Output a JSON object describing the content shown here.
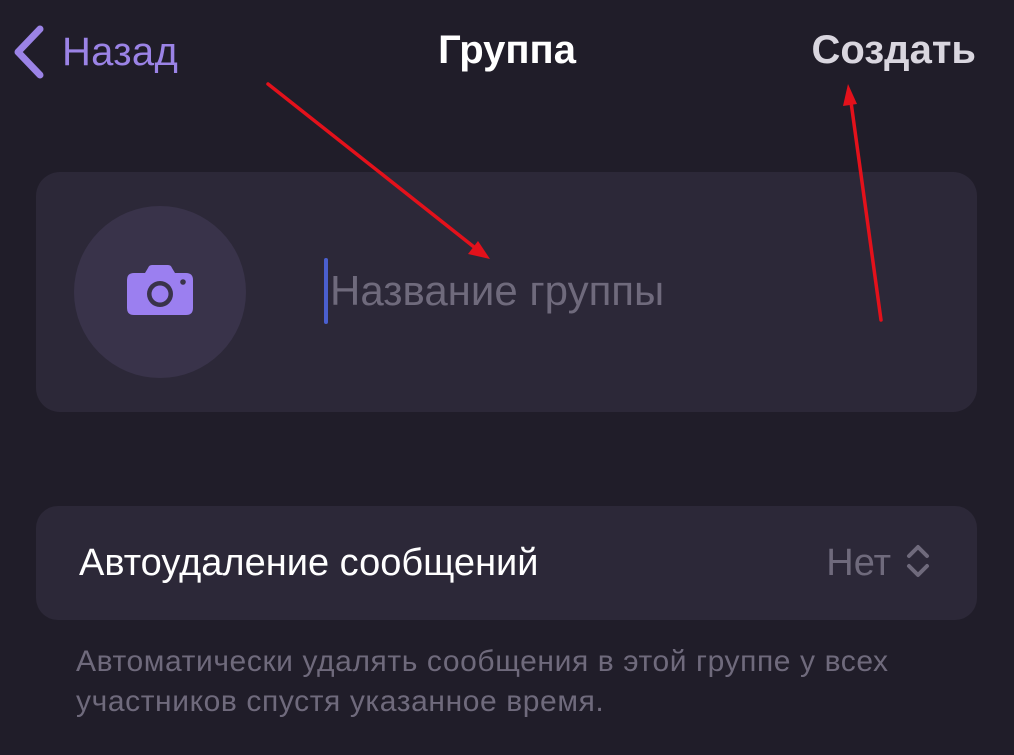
{
  "nav": {
    "back_label": "Назад",
    "title": "Группа",
    "create_label": "Создать"
  },
  "group": {
    "name_placeholder": "Название группы",
    "name_value": ""
  },
  "auto_delete": {
    "label": "Автоудаление сообщений",
    "value": "Нет",
    "footnote": "Автоматически удалять сообщения в этой группе у всех участников спустя указанное время."
  },
  "colors": {
    "background": "#201d29",
    "card": "#2c2838",
    "accent": "#9b83e6",
    "secondary_text": "#6f6a7c",
    "annotation_arrow": "#e3111b"
  },
  "icons": {
    "back": "chevron-left-icon",
    "photo": "camera-icon",
    "value_selector": "chevron-up-down-icon"
  }
}
